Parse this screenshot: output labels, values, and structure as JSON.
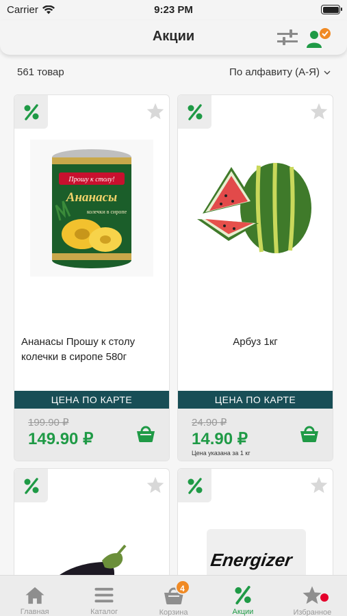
{
  "status": {
    "carrier": "Carrier",
    "time": "9:23 PM"
  },
  "header": {
    "title": "Акции"
  },
  "listing": {
    "count_text": "561 товар",
    "sort_label": "По алфавиту (А-Я)"
  },
  "products": [
    {
      "name": "Ананасы Прошу к столу колечки в сиропе 580г",
      "name_align": "left",
      "price_label": "ЦЕНА ПО КАРТЕ",
      "old_price": "199.90 ₽",
      "new_price": "149.90 ₽",
      "note": "",
      "image": "canned-pineapple-image",
      "can_brand": "Прошу к столу!",
      "can_title": "Ананасы",
      "can_sub": "колечки в сиропе"
    },
    {
      "name": "Арбуз 1кг",
      "name_align": "center",
      "price_label": "ЦЕНА ПО КАРТЕ",
      "old_price": "24.90 ₽",
      "new_price": "14.90 ₽",
      "note": "Цена указана за 1 кг",
      "image": "watermelon-image"
    },
    {
      "name": "",
      "image": "eggplant-image"
    },
    {
      "name": "",
      "image": "energizer-battery-image",
      "brand_text": "Energizer"
    }
  ],
  "tabs": [
    {
      "label": "Главная",
      "icon": "home-icon",
      "active": false
    },
    {
      "label": "Каталог",
      "icon": "menu-icon",
      "active": false
    },
    {
      "label": "Корзина",
      "icon": "basket-icon",
      "active": false,
      "badge": "4"
    },
    {
      "label": "Акции",
      "icon": "percent-icon",
      "active": true
    },
    {
      "label": "Избранное",
      "icon": "star-icon",
      "active": false,
      "dot": true
    }
  ],
  "colors": {
    "accent": "#1f9a46",
    "card_price_bar": "#184e56",
    "badge": "#f08a24",
    "dot": "#e4002b"
  }
}
